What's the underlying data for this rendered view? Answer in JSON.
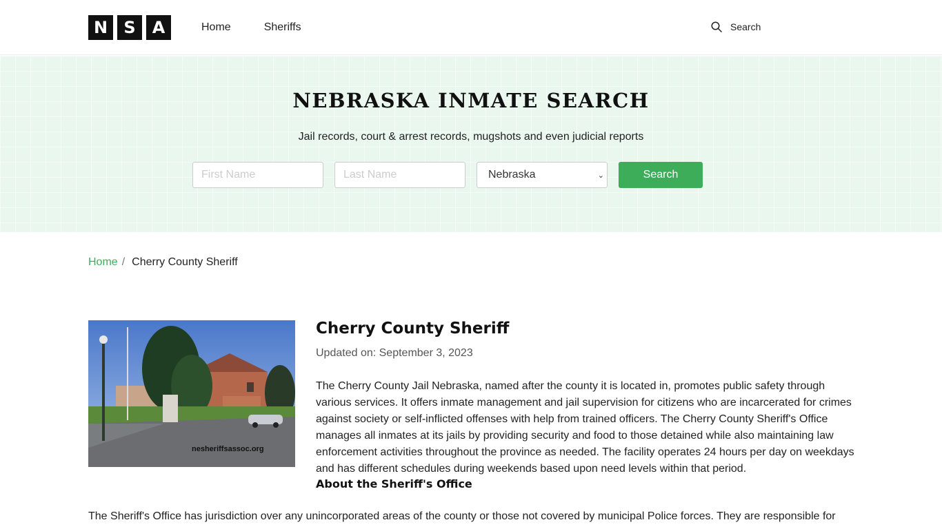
{
  "header": {
    "logo_letters": [
      "N",
      "S",
      "A"
    ],
    "nav": [
      {
        "label": "Home"
      },
      {
        "label": "Sheriffs"
      }
    ],
    "search_label": "Search"
  },
  "hero": {
    "title": "NEBRASKA INMATE SEARCH",
    "subtitle": "Jail records, court & arrest records, mugshots and even judicial reports",
    "first_name_placeholder": "First Name",
    "last_name_placeholder": "Last Name",
    "state_selected": "Nebraska",
    "search_button": "Search",
    "accent_color": "#3ead59"
  },
  "breadcrumb": {
    "home": "Home",
    "separator": "/",
    "current": "Cherry County Sheriff"
  },
  "article": {
    "photo_watermark": "nesheriffsassoc.org",
    "title": "Cherry County Sheriff",
    "updated": "Updated on: September 3, 2023",
    "paragraph": "The Cherry County Jail Nebraska, named after the county it is located in, promotes public safety through various services. It offers inmate management and jail supervision for citizens who are incarcerated for crimes against society or self-inflicted offenses with help from trained officers. The Cherry County Sheriff's Office manages all inmates at its jails by providing security and food to those detained while also maintaining law enforcement activities throughout the province as needed. The facility operates 24 hours per day on weekdays and has different schedules during weekends based upon need levels within that period.",
    "about_heading": "About the Sheriff's Office",
    "paragraph_2": "The Sheriff's Office has jurisdiction over any unincorporated areas of the county or those not covered by municipal Police forces. They are responsible for"
  }
}
